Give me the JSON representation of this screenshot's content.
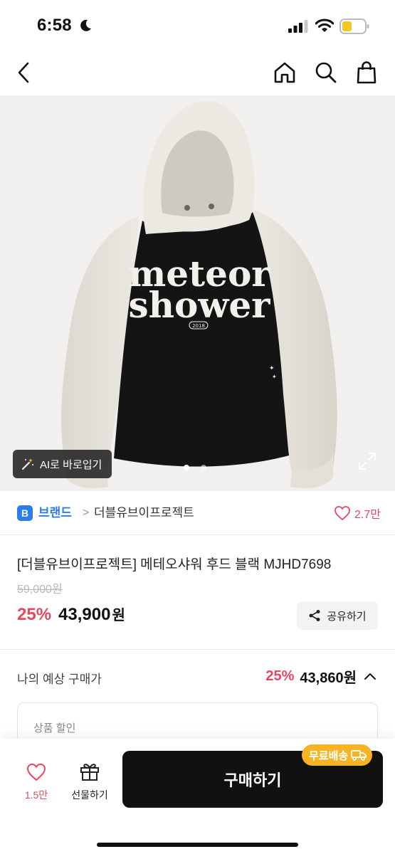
{
  "status_bar": {
    "time": "6:58"
  },
  "nav": {
    "back_icon": "chevron-left-icon",
    "home_icon": "home-icon",
    "search_icon": "search-icon",
    "cart_icon": "shopping-bag-icon"
  },
  "product_image": {
    "print_line1": "meteor",
    "print_line2": "shower",
    "print_badge": "2018",
    "ai_button_label": "AI로 바로입기",
    "slide_count": 2,
    "active_slide": 1
  },
  "brand": {
    "badge": "B",
    "label": "브랜드",
    "separator": ">",
    "name": "더블유브이프로젝트",
    "like_count": "2.7만"
  },
  "product": {
    "title": "[더블유브이프로젝트] 메테오샤워 후드 블랙 MJHD7698",
    "original_price": "59,000원",
    "discount": "25%",
    "sale_price": "43,900",
    "currency": "원",
    "share_label": "공유하기"
  },
  "expected": {
    "label": "나의 예상 구매가",
    "discount": "25%",
    "price": "43,860원"
  },
  "discount_box": {
    "label": "상품 할인"
  },
  "bottom_bar": {
    "like_count": "1.5만",
    "gift_label": "선물하기",
    "buy_label": "구매하기",
    "free_shipping": "무료배송"
  },
  "colors": {
    "accent_red": "#e8475f",
    "brand_blue": "#2b7de9",
    "shipping_yellow": "#f6b425",
    "button_black": "#111111"
  }
}
